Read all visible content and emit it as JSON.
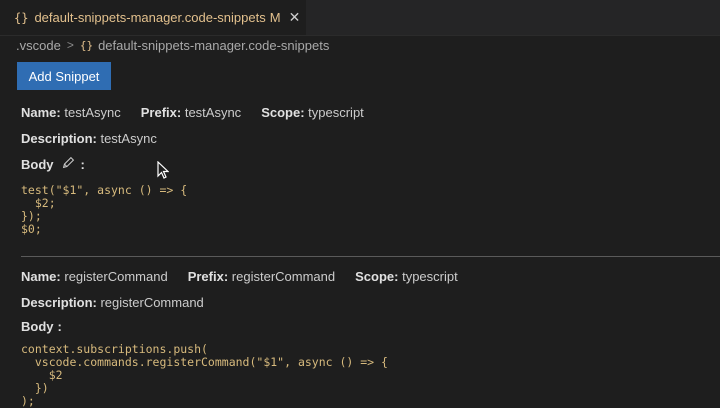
{
  "tab": {
    "icon": "{}",
    "title": "default-snippets-manager.code-snippets",
    "modified": "M",
    "close": "✕"
  },
  "breadcrumb": {
    "folder": ".vscode",
    "separator": ">",
    "file_icon": "{}",
    "file": "default-snippets-manager.code-snippets"
  },
  "toolbar": {
    "add_label": "Add Snippet"
  },
  "labels": {
    "name": "Name:",
    "prefix": "Prefix:",
    "scope": "Scope:",
    "description": "Description:",
    "body": "Body",
    "colon": ":"
  },
  "snippets": [
    {
      "name": "testAsync",
      "prefix": "testAsync",
      "scope": "typescript",
      "description": "testAsync",
      "body": "test(\"$1\", async () => {\n  $2;\n});\n$0;"
    },
    {
      "name": "registerCommand",
      "prefix": "registerCommand",
      "scope": "typescript",
      "description": "registerCommand",
      "body": "context.subscriptions.push(\n  vscode.commands.registerCommand(\"$1\", async () => {\n    $2\n  })\n);"
    }
  ],
  "colors": {
    "accent": "#2f6db3",
    "code": "#d7ba7d",
    "tab_text": "#e2c08d",
    "background": "#1e1e1e"
  },
  "icons": {
    "edit": "pencil-icon",
    "cursor": "mouse-pointer-icon"
  }
}
